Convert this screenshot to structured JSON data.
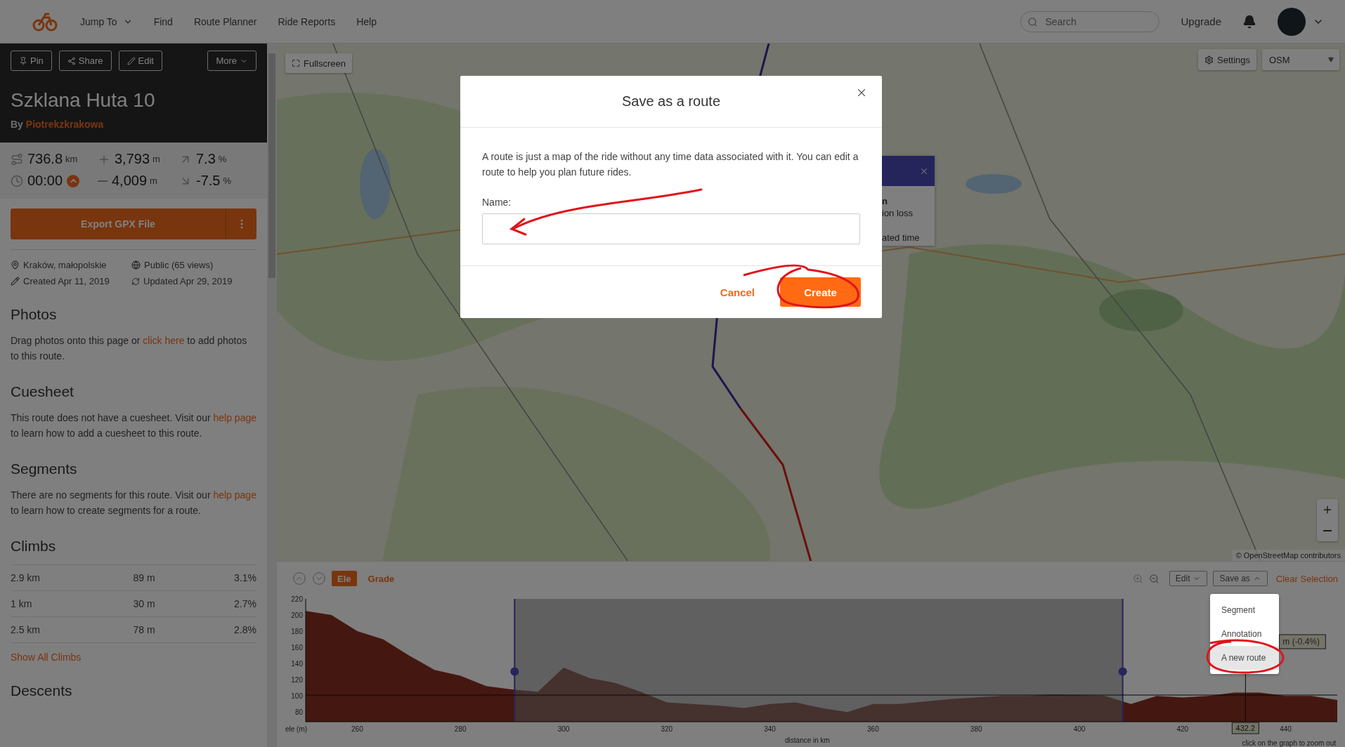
{
  "nav": {
    "items": [
      {
        "label": "Jump To",
        "kind": "dropdown"
      },
      {
        "label": "Find",
        "kind": "link"
      },
      {
        "label": "Route Planner",
        "kind": "link"
      },
      {
        "label": "Ride Reports",
        "kind": "link"
      },
      {
        "label": "Help",
        "kind": "link"
      }
    ],
    "search": {
      "placeholder": "Search"
    },
    "upgrade": "Upgrade"
  },
  "sidebar": {
    "actions": [
      {
        "label": "Pin",
        "kind": "pin"
      },
      {
        "label": "Share",
        "kind": "share"
      },
      {
        "label": "Edit",
        "kind": "edit"
      }
    ],
    "more": "More",
    "title": "Szklana Huta 10",
    "by": "By",
    "author": "Piotrekzkrakowa",
    "stats": [
      {
        "kind": "distance",
        "value": "736.8",
        "unit": "km"
      },
      {
        "kind": "gain",
        "value": "3,793",
        "unit": "m"
      },
      {
        "kind": "grade",
        "value": "7.3",
        "unit": "%"
      },
      {
        "kind": "time",
        "value": "00:00"
      },
      {
        "kind": "loss",
        "value": "4,009",
        "unit": "m"
      },
      {
        "kind": "descent",
        "value": "-7.5",
        "unit": "%"
      }
    ],
    "export": "Export GPX File",
    "meta": [
      {
        "kind": "location",
        "text": "Kraków, małopolskie"
      },
      {
        "kind": "visibility",
        "text": "Public (65 views)"
      },
      {
        "kind": "created",
        "text": "Created Apr 11, 2019"
      },
      {
        "kind": "updated",
        "text": "Updated Apr 29, 2019"
      }
    ],
    "sections": [
      {
        "title": "Photos",
        "parts": [
          {
            "text": "Drag photos onto this page or "
          },
          {
            "link": "click here"
          },
          {
            "text": " to add photos to this route."
          }
        ]
      },
      {
        "title": "Cuesheet",
        "parts": [
          {
            "text": "This route does not have a cuesheet. Visit our "
          },
          {
            "link": "help page"
          },
          {
            "text": " to learn how to add a cuesheet to this route."
          }
        ]
      },
      {
        "title": "Segments",
        "parts": [
          {
            "text": "There are no segments for this route. Visit our "
          },
          {
            "link": "help page"
          },
          {
            "text": " to learn how to create segments for a route."
          }
        ]
      }
    ],
    "climbs": {
      "title": "Climbs",
      "rows": [
        [
          "2.9 km",
          "89 m",
          "3.1%"
        ],
        [
          "1 km",
          "30 m",
          "2.7%"
        ],
        [
          "2.5 km",
          "78 m",
          "2.8%"
        ]
      ],
      "show_all": "Show All Climbs"
    },
    "descents_title": "Descents"
  },
  "map": {
    "kind": "picture",
    "fullscreen": "Fullscreen",
    "settings": "Settings",
    "layer": "OSM",
    "attribution": "© OpenStreetMap contributors"
  },
  "popup": {
    "texts": [
      "n",
      "ion loss",
      "ated time"
    ]
  },
  "modal": {
    "title": "Save as a route",
    "body": "A route is just a map of the ride without any time data associated with it. You can edit a route to help you plan future rides.",
    "name_label": "Name:",
    "cancel": "Cancel",
    "create": "Create"
  },
  "elevation": {
    "tabs": [
      {
        "label": "Ele",
        "selected": true
      },
      {
        "label": "Grade",
        "selected": false
      }
    ],
    "edit": "Edit",
    "save_as": "Save as",
    "clear": "Clear Selection",
    "menu": [
      {
        "label": "Segment",
        "selected": false
      },
      {
        "label": "Annotation",
        "selected": false
      },
      {
        "label": "A new route",
        "selected": true
      }
    ],
    "cursor_distance": "432.2",
    "cursor_readout": "m (-0.4%)",
    "hint": "click on the graph to zoom out",
    "chart_data": {
      "type": "area",
      "xlabel": "distance in km",
      "ylabel": "ele (m)",
      "x": [
        250,
        255,
        260,
        265,
        270,
        275,
        280,
        285,
        290,
        295,
        300,
        305,
        310,
        315,
        320,
        325,
        330,
        335,
        340,
        345,
        350,
        355,
        360,
        365,
        370,
        375,
        380,
        385,
        390,
        395,
        400,
        405,
        410,
        415,
        420,
        425,
        430,
        435,
        440,
        445,
        450
      ],
      "series": [
        {
          "color": "#8b2f22",
          "values": [
            205,
            200,
            180,
            170,
            150,
            132,
            125,
            112,
            108,
            105,
            135,
            122,
            116,
            105,
            92,
            90,
            88,
            85,
            90,
            92,
            85,
            80,
            90,
            90,
            93,
            96,
            98,
            100,
            100,
            102,
            101,
            100,
            90,
            100,
            98,
            100,
            104,
            104,
            100,
            100,
            95
          ]
        }
      ],
      "xlim": [
        250,
        450
      ],
      "ylim": [
        68,
        220
      ],
      "xticks": [
        260,
        280,
        300,
        320,
        340,
        360,
        380,
        400,
        420,
        440
      ],
      "yticks": [
        80,
        100,
        120,
        140,
        160,
        180,
        200,
        220
      ],
      "ref_lines": [
        {
          "axis": "x",
          "value": 290.5,
          "color": "#4a4ab8"
        },
        {
          "axis": "x",
          "value": 408.4,
          "color": "#4a4ab8"
        },
        {
          "axis": "x",
          "value": 432.2
        },
        {
          "axis": "y",
          "value": 101
        }
      ]
    }
  }
}
